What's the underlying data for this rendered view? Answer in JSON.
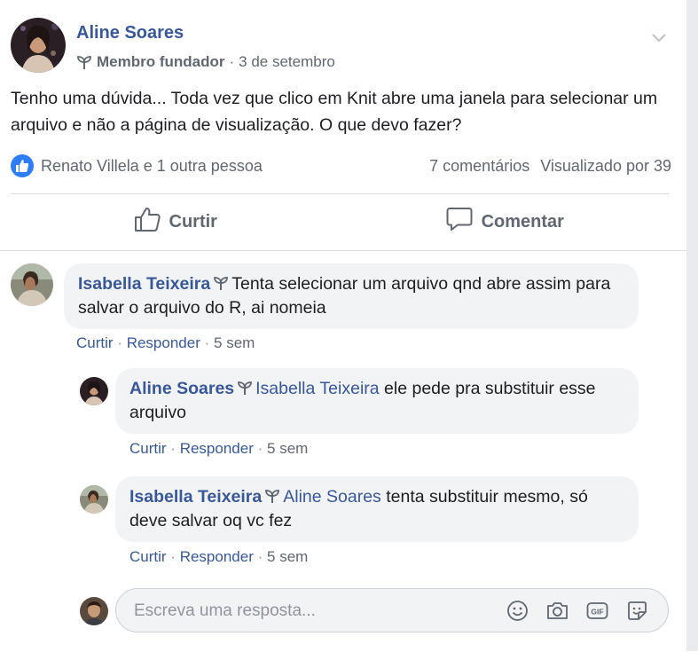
{
  "post": {
    "author": "Aline Soares",
    "badge": "Membro fundador",
    "separator": "·",
    "date": "3 de setembro",
    "text": "Tenho uma dúvida... Toda vez que clico em Knit abre uma janela para selecionar um arquivo e não a página de visualização. O que devo fazer?",
    "reactions_text": "Renato Villela e 1 outra pessoa",
    "comments_count": "7 comentários",
    "views": "Visualizado por 39"
  },
  "actions": {
    "like_label": "Curtir",
    "comment_label": "Comentar"
  },
  "comments": [
    {
      "author": "Isabella Teixeira",
      "mention": "",
      "text": "Tenta selecionar um arquivo qnd abre assim para salvar o arquivo do R, ai nomeia",
      "like": "Curtir",
      "reply": "Responder",
      "time": "5 sem"
    },
    {
      "author": "Aline Soares",
      "mention": "Isabella Teixeira",
      "text": "ele pede pra substituir esse arquivo",
      "like": "Curtir",
      "reply": "Responder",
      "time": "5 sem"
    },
    {
      "author": "Isabella Teixeira",
      "mention": "Aline Soares",
      "text": "tenta substituir mesmo, só deve salvar oq vc fez",
      "like": "Curtir",
      "reply": "Responder",
      "time": "5 sem"
    }
  ],
  "meta_separator": "·",
  "reply_box": {
    "placeholder": "Escreva uma resposta...",
    "icons": [
      "emoji-icon",
      "camera-icon",
      "gif-icon",
      "sticker-icon"
    ]
  },
  "colors": {
    "link": "#385898",
    "secondary_text": "#606770",
    "bubble_bg": "#f2f3f5",
    "like_blue": "#2e7cf6",
    "divider": "#dadde1",
    "gutter": "#e9ebee"
  }
}
